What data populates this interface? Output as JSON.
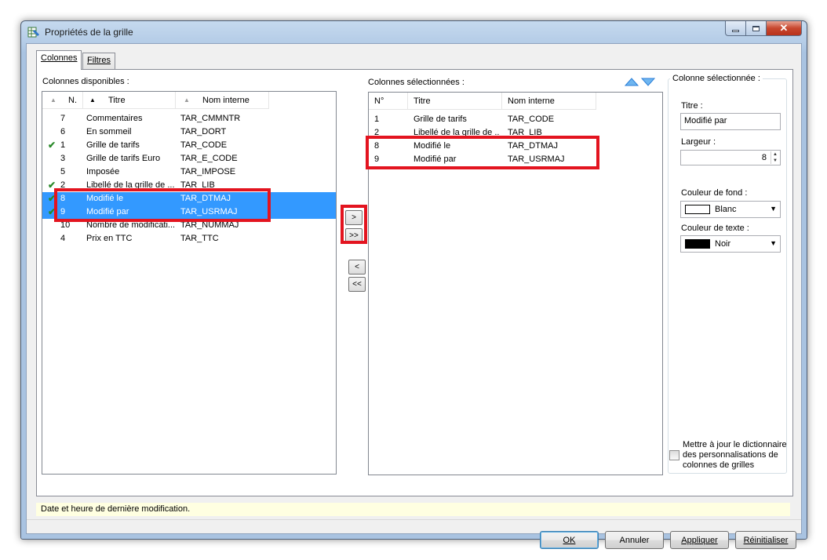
{
  "window": {
    "title": "Propriétés de la grille"
  },
  "tabs": [
    {
      "label": "Colonnes",
      "active": true
    },
    {
      "label": "Filtres",
      "active": false
    }
  ],
  "available": {
    "label": "Colonnes disponibles :",
    "headers": {
      "n": "N.",
      "title": "Titre",
      "internal": "Nom interne"
    },
    "rows": [
      {
        "n": "7",
        "title": "Commentaires",
        "internal": "TAR_CMMNTR",
        "checked": false,
        "selected": false
      },
      {
        "n": "6",
        "title": "En sommeil",
        "internal": "TAR_DORT",
        "checked": false,
        "selected": false
      },
      {
        "n": "1",
        "title": "Grille de tarifs",
        "internal": "TAR_CODE",
        "checked": true,
        "selected": false
      },
      {
        "n": "3",
        "title": "Grille de tarifs Euro",
        "internal": "TAR_E_CODE",
        "checked": false,
        "selected": false
      },
      {
        "n": "5",
        "title": "Imposée",
        "internal": "TAR_IMPOSE",
        "checked": false,
        "selected": false
      },
      {
        "n": "2",
        "title": "Libellé de la grille de ...",
        "internal": "TAR_LIB",
        "checked": true,
        "selected": false
      },
      {
        "n": "8",
        "title": "Modifié le",
        "internal": "TAR_DTMAJ",
        "checked": true,
        "selected": true
      },
      {
        "n": "9",
        "title": "Modifié par",
        "internal": "TAR_USRMAJ",
        "checked": true,
        "selected": true
      },
      {
        "n": "10",
        "title": "Nombre de modificati...",
        "internal": "TAR_NUMMAJ",
        "checked": false,
        "selected": false
      },
      {
        "n": "4",
        "title": "Prix en TTC",
        "internal": "TAR_TTC",
        "checked": false,
        "selected": false
      }
    ]
  },
  "transfer_buttons": {
    "add": ">",
    "add_all": ">>",
    "remove": "<",
    "remove_all": "<<"
  },
  "selected": {
    "label": "Colonnes sélectionnées :",
    "headers": {
      "n": "N°",
      "title": "Titre",
      "internal": "Nom interne"
    },
    "rows": [
      {
        "n": "1",
        "title": "Grille de tarifs",
        "internal": "TAR_CODE"
      },
      {
        "n": "2",
        "title": "Libellé de la grille de ...",
        "internal": "TAR_LIB"
      },
      {
        "n": "8",
        "title": "Modifié le",
        "internal": "TAR_DTMAJ"
      },
      {
        "n": "9",
        "title": "Modifié par",
        "internal": "TAR_USRMAJ"
      }
    ]
  },
  "properties": {
    "group_title": "Colonne sélectionnée :",
    "title_label": "Titre :",
    "title_value": "Modifié par",
    "width_label": "Largeur :",
    "width_value": "8",
    "bg_label": "Couleur de fond :",
    "bg_value": "Blanc",
    "bg_color": "#ffffff",
    "text_label": "Couleur de texte :",
    "text_value": "Noir",
    "text_color": "#000000",
    "dict_line1": "Mettre à jour le dictionnaire",
    "dict_line2": "des personnalisations de",
    "dict_line3": "colonnes de grilles"
  },
  "status": "Date et heure de dernière modification.",
  "buttons": {
    "ok": "OK",
    "cancel": "Annuler",
    "apply": "Appliquer",
    "reset": "Réinitialiser"
  },
  "colors": {
    "selection": "#3399ff",
    "highlight": "#e3141f",
    "accent_arrow": "#2b7fd8"
  }
}
